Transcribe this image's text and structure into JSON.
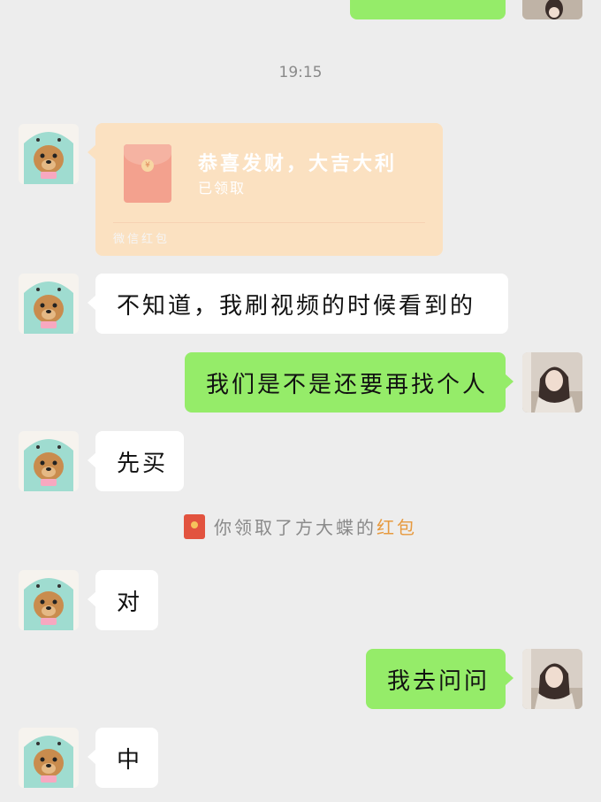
{
  "time_divider": "19:15",
  "red_packet": {
    "title": "恭喜发财，大吉大利",
    "status": "已领取",
    "footer": "微信红包",
    "coin_symbol": "¥"
  },
  "messages": [
    {
      "side": "left",
      "text": "不知道，我刷视频的时候看到的"
    },
    {
      "side": "right",
      "text": "我们是不是还要再找个人"
    },
    {
      "side": "left",
      "text": "先买"
    },
    {
      "side": "left",
      "text": "对"
    },
    {
      "side": "right",
      "text": "我去问问"
    },
    {
      "side": "left",
      "text": "中"
    }
  ],
  "system_notice": {
    "prefix": "你领取了方大蝶的",
    "link": "红包"
  },
  "colors": {
    "background": "#ededed",
    "bubble_left": "#ffffff",
    "bubble_right": "#95ec69",
    "red_packet_received": "#fbe1c1",
    "notice_link": "#e79a3f"
  },
  "icons": {
    "friend_avatar": "cartoon-dog-in-teal-hood-avatar",
    "self_avatar": "girl-photo-avatar",
    "red_packet_icon": "red-envelope-icon"
  }
}
